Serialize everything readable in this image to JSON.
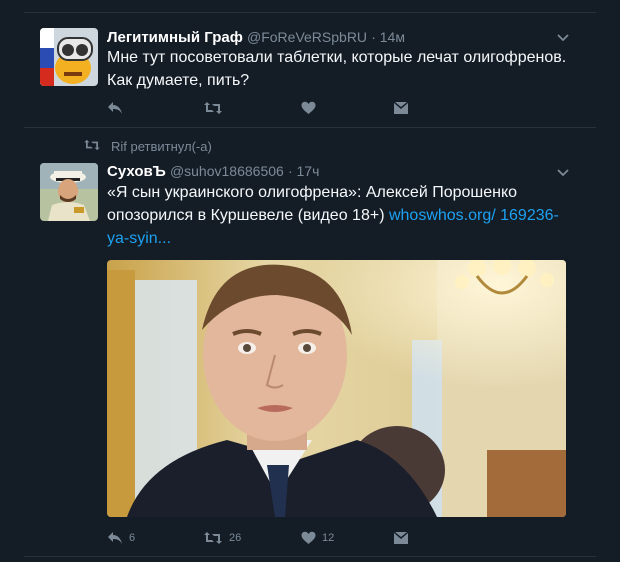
{
  "tweet1": {
    "name": "Легитимный Граф",
    "handle": "@FoReVeRSpbRU",
    "time": "· 14м",
    "text": "Мне тут посоветовали таблетки, которые лечат олигофренов. Как думаете, пить?"
  },
  "tweet2": {
    "retweet_note": "Rif ретвитнул(-а)",
    "name": "СуховЪ",
    "handle": "@suhov18686506",
    "time": "· 17ч",
    "text": "«Я сын украинского олигофрена»: Алексей Порошенко опозорился в Куршевеле (видео 18+) ",
    "link": "whoswhos.org/ 169236-ya-syin...",
    "replies": "6",
    "retweets": "26",
    "likes": "12"
  },
  "colors": {
    "background": "#141d26",
    "text": "#ffffff",
    "muted": "#7c8a98",
    "link": "#1da1f2",
    "divider": "#26333f"
  },
  "icons": [
    "reply-icon",
    "retweet-icon",
    "like-icon",
    "message-icon",
    "chevron-down-icon"
  ]
}
